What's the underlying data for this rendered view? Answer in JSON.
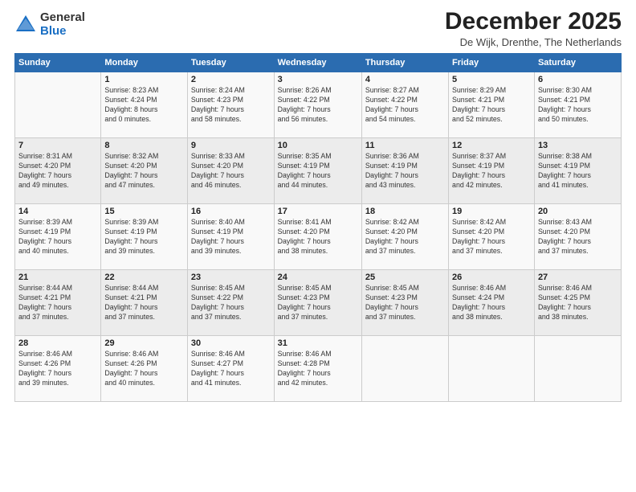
{
  "logo": {
    "general": "General",
    "blue": "Blue"
  },
  "title": "December 2025",
  "location": "De Wijk, Drenthe, The Netherlands",
  "days_header": [
    "Sunday",
    "Monday",
    "Tuesday",
    "Wednesday",
    "Thursday",
    "Friday",
    "Saturday"
  ],
  "weeks": [
    [
      {
        "day": "",
        "info": ""
      },
      {
        "day": "1",
        "info": "Sunrise: 8:23 AM\nSunset: 4:24 PM\nDaylight: 8 hours\nand 0 minutes."
      },
      {
        "day": "2",
        "info": "Sunrise: 8:24 AM\nSunset: 4:23 PM\nDaylight: 7 hours\nand 58 minutes."
      },
      {
        "day": "3",
        "info": "Sunrise: 8:26 AM\nSunset: 4:22 PM\nDaylight: 7 hours\nand 56 minutes."
      },
      {
        "day": "4",
        "info": "Sunrise: 8:27 AM\nSunset: 4:22 PM\nDaylight: 7 hours\nand 54 minutes."
      },
      {
        "day": "5",
        "info": "Sunrise: 8:29 AM\nSunset: 4:21 PM\nDaylight: 7 hours\nand 52 minutes."
      },
      {
        "day": "6",
        "info": "Sunrise: 8:30 AM\nSunset: 4:21 PM\nDaylight: 7 hours\nand 50 minutes."
      }
    ],
    [
      {
        "day": "7",
        "info": "Sunrise: 8:31 AM\nSunset: 4:20 PM\nDaylight: 7 hours\nand 49 minutes."
      },
      {
        "day": "8",
        "info": "Sunrise: 8:32 AM\nSunset: 4:20 PM\nDaylight: 7 hours\nand 47 minutes."
      },
      {
        "day": "9",
        "info": "Sunrise: 8:33 AM\nSunset: 4:20 PM\nDaylight: 7 hours\nand 46 minutes."
      },
      {
        "day": "10",
        "info": "Sunrise: 8:35 AM\nSunset: 4:19 PM\nDaylight: 7 hours\nand 44 minutes."
      },
      {
        "day": "11",
        "info": "Sunrise: 8:36 AM\nSunset: 4:19 PM\nDaylight: 7 hours\nand 43 minutes."
      },
      {
        "day": "12",
        "info": "Sunrise: 8:37 AM\nSunset: 4:19 PM\nDaylight: 7 hours\nand 42 minutes."
      },
      {
        "day": "13",
        "info": "Sunrise: 8:38 AM\nSunset: 4:19 PM\nDaylight: 7 hours\nand 41 minutes."
      }
    ],
    [
      {
        "day": "14",
        "info": "Sunrise: 8:39 AM\nSunset: 4:19 PM\nDaylight: 7 hours\nand 40 minutes."
      },
      {
        "day": "15",
        "info": "Sunrise: 8:39 AM\nSunset: 4:19 PM\nDaylight: 7 hours\nand 39 minutes."
      },
      {
        "day": "16",
        "info": "Sunrise: 8:40 AM\nSunset: 4:19 PM\nDaylight: 7 hours\nand 39 minutes."
      },
      {
        "day": "17",
        "info": "Sunrise: 8:41 AM\nSunset: 4:20 PM\nDaylight: 7 hours\nand 38 minutes."
      },
      {
        "day": "18",
        "info": "Sunrise: 8:42 AM\nSunset: 4:20 PM\nDaylight: 7 hours\nand 37 minutes."
      },
      {
        "day": "19",
        "info": "Sunrise: 8:42 AM\nSunset: 4:20 PM\nDaylight: 7 hours\nand 37 minutes."
      },
      {
        "day": "20",
        "info": "Sunrise: 8:43 AM\nSunset: 4:20 PM\nDaylight: 7 hours\nand 37 minutes."
      }
    ],
    [
      {
        "day": "21",
        "info": "Sunrise: 8:44 AM\nSunset: 4:21 PM\nDaylight: 7 hours\nand 37 minutes."
      },
      {
        "day": "22",
        "info": "Sunrise: 8:44 AM\nSunset: 4:21 PM\nDaylight: 7 hours\nand 37 minutes."
      },
      {
        "day": "23",
        "info": "Sunrise: 8:45 AM\nSunset: 4:22 PM\nDaylight: 7 hours\nand 37 minutes."
      },
      {
        "day": "24",
        "info": "Sunrise: 8:45 AM\nSunset: 4:23 PM\nDaylight: 7 hours\nand 37 minutes."
      },
      {
        "day": "25",
        "info": "Sunrise: 8:45 AM\nSunset: 4:23 PM\nDaylight: 7 hours\nand 37 minutes."
      },
      {
        "day": "26",
        "info": "Sunrise: 8:46 AM\nSunset: 4:24 PM\nDaylight: 7 hours\nand 38 minutes."
      },
      {
        "day": "27",
        "info": "Sunrise: 8:46 AM\nSunset: 4:25 PM\nDaylight: 7 hours\nand 38 minutes."
      }
    ],
    [
      {
        "day": "28",
        "info": "Sunrise: 8:46 AM\nSunset: 4:26 PM\nDaylight: 7 hours\nand 39 minutes."
      },
      {
        "day": "29",
        "info": "Sunrise: 8:46 AM\nSunset: 4:26 PM\nDaylight: 7 hours\nand 40 minutes."
      },
      {
        "day": "30",
        "info": "Sunrise: 8:46 AM\nSunset: 4:27 PM\nDaylight: 7 hours\nand 41 minutes."
      },
      {
        "day": "31",
        "info": "Sunrise: 8:46 AM\nSunset: 4:28 PM\nDaylight: 7 hours\nand 42 minutes."
      },
      {
        "day": "",
        "info": ""
      },
      {
        "day": "",
        "info": ""
      },
      {
        "day": "",
        "info": ""
      }
    ]
  ]
}
